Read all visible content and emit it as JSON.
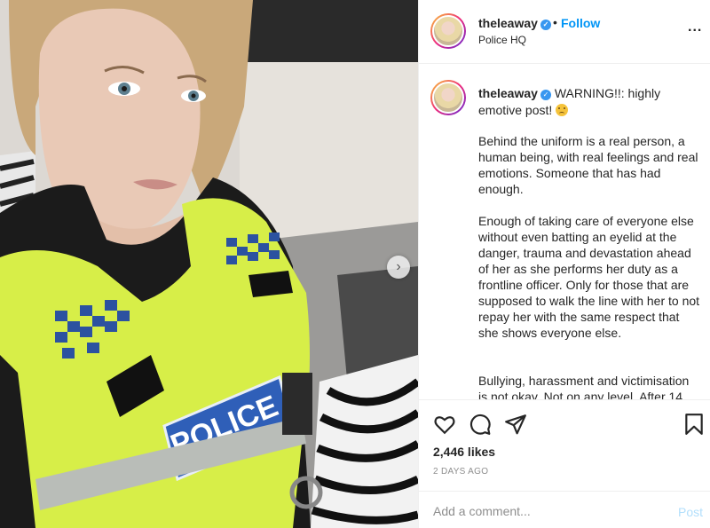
{
  "header": {
    "username": "theleaway",
    "verified_icon": "verified-badge-icon",
    "separator": "•",
    "follow_label": "Follow",
    "location": "Police HQ",
    "more_label": "..."
  },
  "photo": {
    "description_icon": "selfie-police-photo",
    "vest_text": "POLICE",
    "next_label": "›"
  },
  "caption": {
    "username": "theleaway",
    "first_line": "WARNING!!: highly emotive post!",
    "paragraphs": [
      "Behind the uniform is a real person, a human being, with real feelings and real emotions. Someone that has had enough.",
      "Enough of taking care of everyone else without even batting an eyelid at the danger, trauma and devastation ahead of her as she performs her duty as a frontline officer. Only for those that are supposed to walk the line with her to not repay her with the same respect that she shows everyone else.",
      "Bullying, harassment and victimisation is not okay. Not on any level. After 14"
    ]
  },
  "actions": {
    "likes": "2,446 likes",
    "time": "2 DAYS AGO"
  },
  "comment": {
    "placeholder": "Add a comment...",
    "post_label": "Post"
  },
  "colors": {
    "accent": "#0095f6",
    "post_disabled": "#b2dffc",
    "hi_vis": "#d9f04a",
    "police_blue": "#2f5fb8"
  }
}
